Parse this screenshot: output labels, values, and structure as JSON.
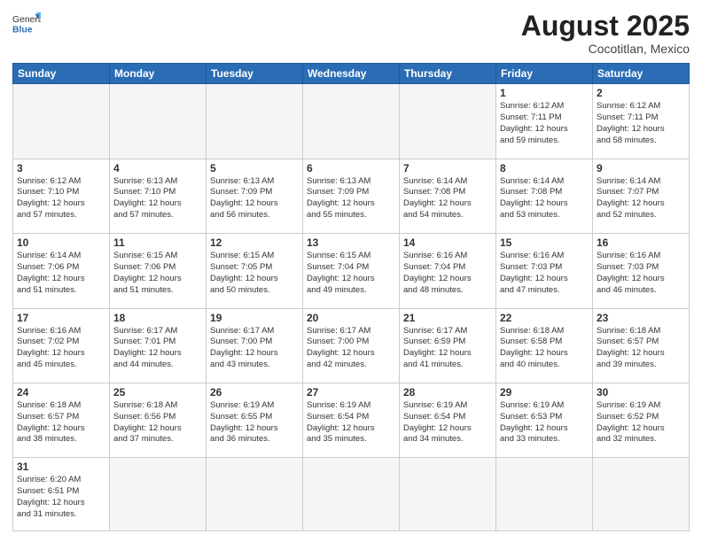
{
  "header": {
    "logo_general": "General",
    "logo_blue": "Blue",
    "month_year": "August 2025",
    "location": "Cocotitlan, Mexico"
  },
  "weekdays": [
    "Sunday",
    "Monday",
    "Tuesday",
    "Wednesday",
    "Thursday",
    "Friday",
    "Saturday"
  ],
  "weeks": [
    [
      {
        "day": "",
        "info": ""
      },
      {
        "day": "",
        "info": ""
      },
      {
        "day": "",
        "info": ""
      },
      {
        "day": "",
        "info": ""
      },
      {
        "day": "",
        "info": ""
      },
      {
        "day": "1",
        "info": "Sunrise: 6:12 AM\nSunset: 7:11 PM\nDaylight: 12 hours\nand 59 minutes."
      },
      {
        "day": "2",
        "info": "Sunrise: 6:12 AM\nSunset: 7:11 PM\nDaylight: 12 hours\nand 58 minutes."
      }
    ],
    [
      {
        "day": "3",
        "info": "Sunrise: 6:12 AM\nSunset: 7:10 PM\nDaylight: 12 hours\nand 57 minutes."
      },
      {
        "day": "4",
        "info": "Sunrise: 6:13 AM\nSunset: 7:10 PM\nDaylight: 12 hours\nand 57 minutes."
      },
      {
        "day": "5",
        "info": "Sunrise: 6:13 AM\nSunset: 7:09 PM\nDaylight: 12 hours\nand 56 minutes."
      },
      {
        "day": "6",
        "info": "Sunrise: 6:13 AM\nSunset: 7:09 PM\nDaylight: 12 hours\nand 55 minutes."
      },
      {
        "day": "7",
        "info": "Sunrise: 6:14 AM\nSunset: 7:08 PM\nDaylight: 12 hours\nand 54 minutes."
      },
      {
        "day": "8",
        "info": "Sunrise: 6:14 AM\nSunset: 7:08 PM\nDaylight: 12 hours\nand 53 minutes."
      },
      {
        "day": "9",
        "info": "Sunrise: 6:14 AM\nSunset: 7:07 PM\nDaylight: 12 hours\nand 52 minutes."
      }
    ],
    [
      {
        "day": "10",
        "info": "Sunrise: 6:14 AM\nSunset: 7:06 PM\nDaylight: 12 hours\nand 51 minutes."
      },
      {
        "day": "11",
        "info": "Sunrise: 6:15 AM\nSunset: 7:06 PM\nDaylight: 12 hours\nand 51 minutes."
      },
      {
        "day": "12",
        "info": "Sunrise: 6:15 AM\nSunset: 7:05 PM\nDaylight: 12 hours\nand 50 minutes."
      },
      {
        "day": "13",
        "info": "Sunrise: 6:15 AM\nSunset: 7:04 PM\nDaylight: 12 hours\nand 49 minutes."
      },
      {
        "day": "14",
        "info": "Sunrise: 6:16 AM\nSunset: 7:04 PM\nDaylight: 12 hours\nand 48 minutes."
      },
      {
        "day": "15",
        "info": "Sunrise: 6:16 AM\nSunset: 7:03 PM\nDaylight: 12 hours\nand 47 minutes."
      },
      {
        "day": "16",
        "info": "Sunrise: 6:16 AM\nSunset: 7:03 PM\nDaylight: 12 hours\nand 46 minutes."
      }
    ],
    [
      {
        "day": "17",
        "info": "Sunrise: 6:16 AM\nSunset: 7:02 PM\nDaylight: 12 hours\nand 45 minutes."
      },
      {
        "day": "18",
        "info": "Sunrise: 6:17 AM\nSunset: 7:01 PM\nDaylight: 12 hours\nand 44 minutes."
      },
      {
        "day": "19",
        "info": "Sunrise: 6:17 AM\nSunset: 7:00 PM\nDaylight: 12 hours\nand 43 minutes."
      },
      {
        "day": "20",
        "info": "Sunrise: 6:17 AM\nSunset: 7:00 PM\nDaylight: 12 hours\nand 42 minutes."
      },
      {
        "day": "21",
        "info": "Sunrise: 6:17 AM\nSunset: 6:59 PM\nDaylight: 12 hours\nand 41 minutes."
      },
      {
        "day": "22",
        "info": "Sunrise: 6:18 AM\nSunset: 6:58 PM\nDaylight: 12 hours\nand 40 minutes."
      },
      {
        "day": "23",
        "info": "Sunrise: 6:18 AM\nSunset: 6:57 PM\nDaylight: 12 hours\nand 39 minutes."
      }
    ],
    [
      {
        "day": "24",
        "info": "Sunrise: 6:18 AM\nSunset: 6:57 PM\nDaylight: 12 hours\nand 38 minutes."
      },
      {
        "day": "25",
        "info": "Sunrise: 6:18 AM\nSunset: 6:56 PM\nDaylight: 12 hours\nand 37 minutes."
      },
      {
        "day": "26",
        "info": "Sunrise: 6:19 AM\nSunset: 6:55 PM\nDaylight: 12 hours\nand 36 minutes."
      },
      {
        "day": "27",
        "info": "Sunrise: 6:19 AM\nSunset: 6:54 PM\nDaylight: 12 hours\nand 35 minutes."
      },
      {
        "day": "28",
        "info": "Sunrise: 6:19 AM\nSunset: 6:54 PM\nDaylight: 12 hours\nand 34 minutes."
      },
      {
        "day": "29",
        "info": "Sunrise: 6:19 AM\nSunset: 6:53 PM\nDaylight: 12 hours\nand 33 minutes."
      },
      {
        "day": "30",
        "info": "Sunrise: 6:19 AM\nSunset: 6:52 PM\nDaylight: 12 hours\nand 32 minutes."
      }
    ],
    [
      {
        "day": "31",
        "info": "Sunrise: 6:20 AM\nSunset: 6:51 PM\nDaylight: 12 hours\nand 31 minutes."
      },
      {
        "day": "",
        "info": ""
      },
      {
        "day": "",
        "info": ""
      },
      {
        "day": "",
        "info": ""
      },
      {
        "day": "",
        "info": ""
      },
      {
        "day": "",
        "info": ""
      },
      {
        "day": "",
        "info": ""
      }
    ]
  ]
}
